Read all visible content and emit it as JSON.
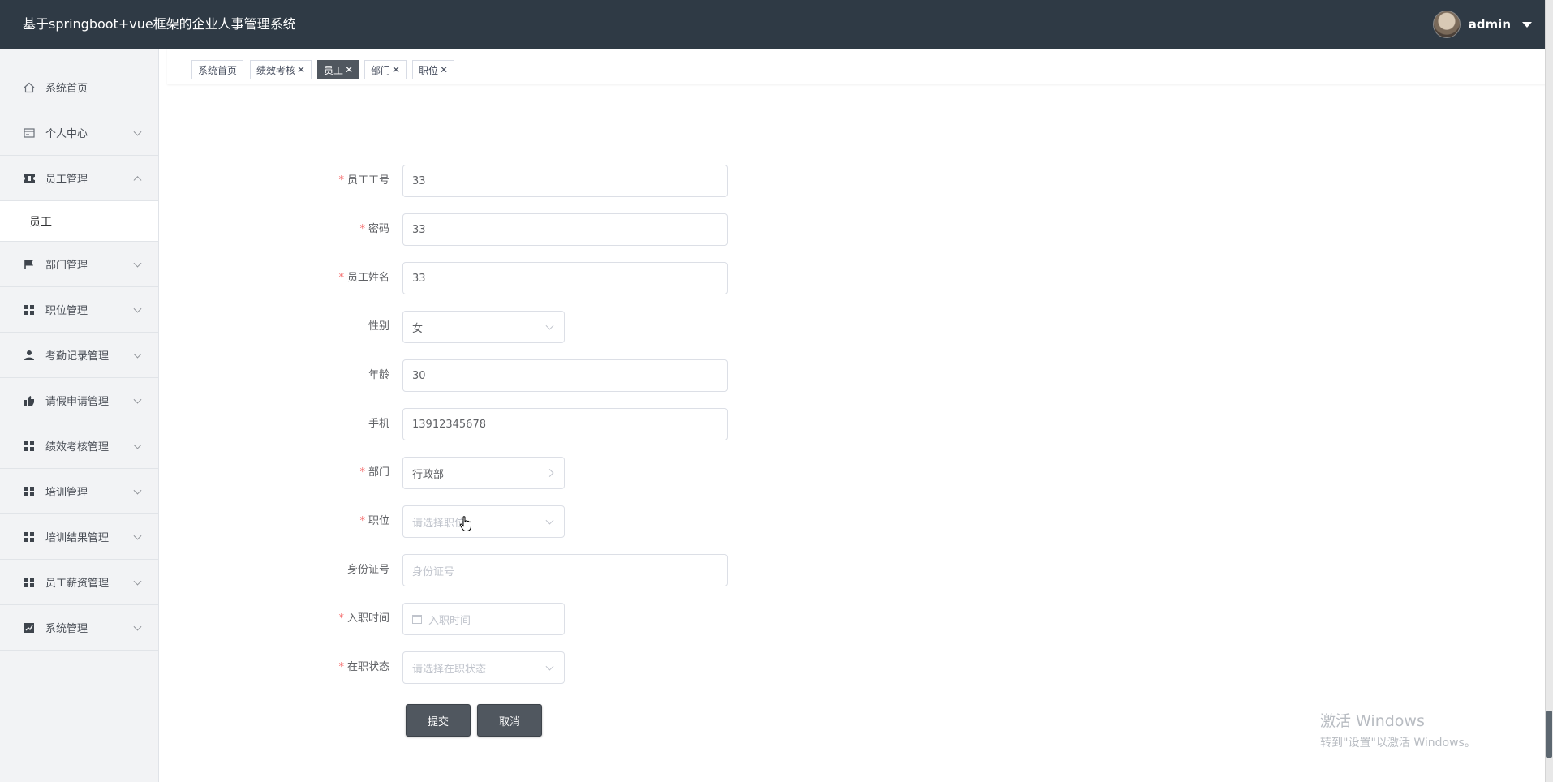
{
  "header": {
    "title": "基于springboot+vue框架的企业人事管理系统",
    "username": "admin"
  },
  "sidebar": {
    "items": [
      {
        "label": "系统首页",
        "icon": "home-icon"
      },
      {
        "label": "个人中心",
        "icon": "card-icon"
      },
      {
        "label": "员工管理",
        "icon": "ticket-icon",
        "expanded": true,
        "sub": [
          {
            "label": "员工"
          }
        ]
      },
      {
        "label": "部门管理",
        "icon": "flag-icon"
      },
      {
        "label": "职位管理",
        "icon": "grid-icon"
      },
      {
        "label": "考勤记录管理",
        "icon": "user-icon"
      },
      {
        "label": "请假申请管理",
        "icon": "thumb-icon"
      },
      {
        "label": "绩效考核管理",
        "icon": "grid-icon"
      },
      {
        "label": "培训管理",
        "icon": "grid-icon"
      },
      {
        "label": "培训结果管理",
        "icon": "grid-icon"
      },
      {
        "label": "员工薪资管理",
        "icon": "grid-icon"
      },
      {
        "label": "系统管理",
        "icon": "chart-icon"
      }
    ]
  },
  "tags": [
    {
      "label": "系统首页",
      "closable": false,
      "active": false
    },
    {
      "label": "绩效考核",
      "closable": true,
      "active": false
    },
    {
      "label": "员工",
      "closable": true,
      "active": true
    },
    {
      "label": "部门",
      "closable": true,
      "active": false
    },
    {
      "label": "职位",
      "closable": true,
      "active": false
    }
  ],
  "form": {
    "employee_no": {
      "label": "员工工号",
      "value": "33",
      "required": true
    },
    "password": {
      "label": "密码",
      "value": "33",
      "required": true
    },
    "name": {
      "label": "员工姓名",
      "value": "33",
      "required": true
    },
    "gender": {
      "label": "性别",
      "value": "女"
    },
    "age": {
      "label": "年龄",
      "value": "30"
    },
    "phone": {
      "label": "手机",
      "value": "13912345678"
    },
    "department": {
      "label": "部门",
      "value": "行政部",
      "required": true
    },
    "position": {
      "label": "职位",
      "placeholder": "请选择职位",
      "required": true
    },
    "id_card": {
      "label": "身份证号",
      "placeholder": "身份证号"
    },
    "hire_date": {
      "label": "入职时间",
      "placeholder": "入职时间",
      "required": true
    },
    "status": {
      "label": "在职状态",
      "placeholder": "请选择在职状态",
      "required": true
    }
  },
  "buttons": {
    "submit": "提交",
    "cancel": "取消"
  },
  "watermark": {
    "line1": "激活 Windows",
    "line2": "转到\"设置\"以激活 Windows。"
  },
  "colors": {
    "header_bg": "#2f3a45",
    "accent": "#50575f",
    "required": "#f56c6c"
  }
}
